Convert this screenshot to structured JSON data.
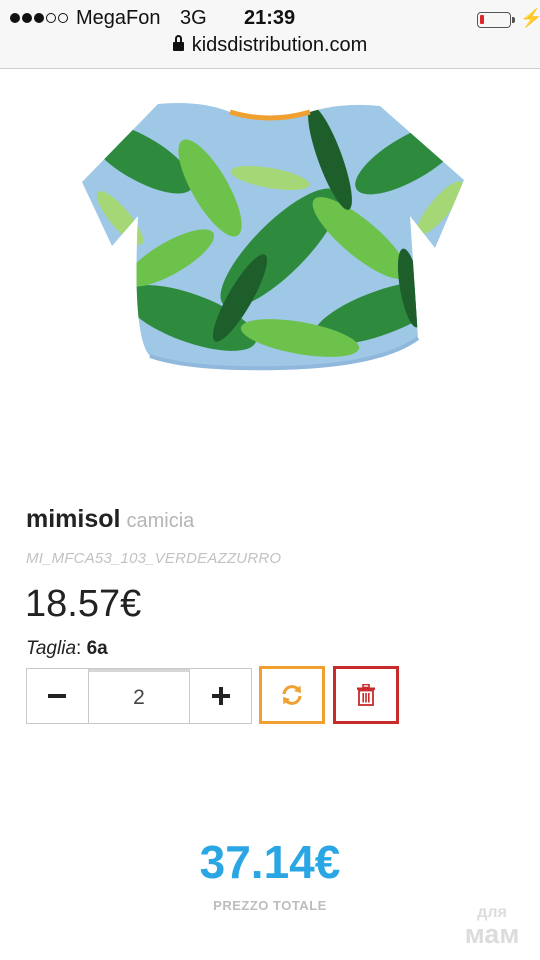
{
  "status_bar": {
    "carrier": "MegaFon",
    "network": "3G",
    "time": "21:39",
    "signal_bars_filled": 3,
    "signal_bars_total": 5,
    "battery_level": 0.15,
    "battery_color": "#e0252b"
  },
  "address_bar": {
    "url": "kidsdistribution.com"
  },
  "product": {
    "brand": "mimisol",
    "category": "camicia",
    "sku": "MI_MFCA53_103_VERDEAZZURRO",
    "price": "18.57€",
    "size_label": "Taglia",
    "size_separator": ": ",
    "size_value": "6a",
    "quantity": "2",
    "minus_label": "−",
    "plus_label": "+",
    "image_icon": "tropical-print-shirt-image"
  },
  "actions": {
    "refresh_icon": "refresh-icon",
    "refresh_color": "#f0a030",
    "delete_icon": "trash-icon",
    "delete_color": "#c92b2b"
  },
  "total": {
    "amount": "37.14€",
    "label": "PREZZO TOTALE",
    "color": "#29a6e3"
  },
  "watermark": {
    "line1": "для",
    "line2": "мам"
  }
}
